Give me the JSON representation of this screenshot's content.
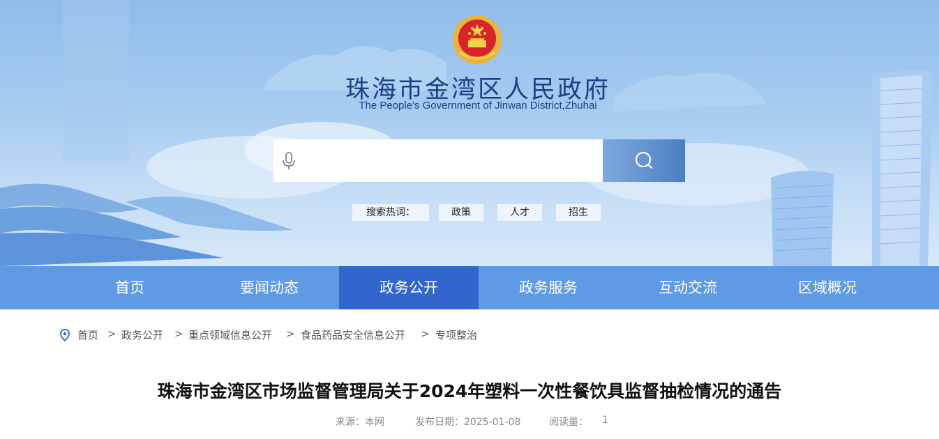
{
  "header": {
    "title": "珠海市金湾区人民政府",
    "subtitle": "The People's Government of Jinwan District,Zhuhai",
    "emblem_icon": "national-emblem-icon"
  },
  "search": {
    "placeholder": "",
    "value": "",
    "mic_icon": "microphone-icon",
    "button_icon": "search-icon",
    "hot_label": "搜索热词：",
    "hot_words": [
      "政策",
      "人才",
      "招生"
    ]
  },
  "nav": {
    "items": [
      "首页",
      "要闻动态",
      "政务公开",
      "政务服务",
      "互动交流",
      "区域概况"
    ],
    "active": "政务公开"
  },
  "breadcrumb": {
    "icon": "location-pin-icon",
    "separator": ">",
    "items": [
      "首页",
      "政务公开",
      "重点领域信息公开",
      "食品药品安全信息公开",
      "专项整治"
    ]
  },
  "article": {
    "title": "珠海市金湾区市场监督管理局关于2024年塑料一次性餐饮具监督抽检情况的通告",
    "source": "来源：本网",
    "date": "发布日期：2025-01-08",
    "views_label": "阅读量：",
    "views_count": "1"
  },
  "colors": {
    "nav_bg": "#5f9ae5",
    "nav_active": "#3366cc",
    "title_blue": "#1a3f86"
  }
}
